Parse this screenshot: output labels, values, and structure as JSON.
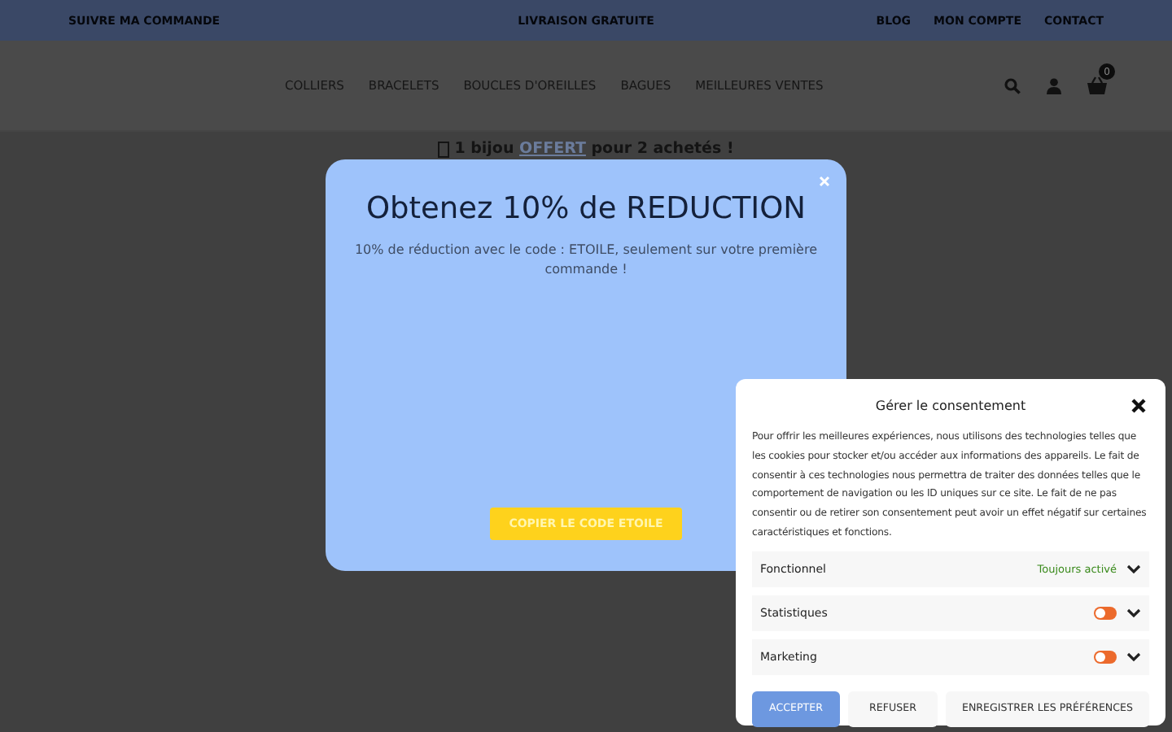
{
  "top_bar": {
    "left": "SUIVRE MA COMMANDE",
    "center": "LIVRAISON GRATUITE",
    "links": [
      "BLOG",
      "MON COMPTE",
      "CONTACT"
    ]
  },
  "nav": {
    "items": [
      "COLLIERS",
      "BRACELETS",
      "BOUCLES D'OREILLES",
      "BAGUES",
      "MEILLEURES VENTES"
    ],
    "cart_count": "0"
  },
  "promo": {
    "before": "1 bijou",
    "link": "OFFERT",
    "after": "pour 2 achetés !"
  },
  "popup": {
    "title": "Obtenez 10% de REDUCTION",
    "text": "10% de réduction avec le code : ETOILE, seulement sur votre première commande !",
    "button": "COPIER LE CODE ETOILE"
  },
  "consent": {
    "title": "Gérer le consentement",
    "text": "Pour offrir les meilleures expériences, nous utilisons des technologies telles que les cookies pour stocker et/ou accéder aux informations des appareils. Le fait de consentir à ces technologies nous permettra de traiter des données telles que le comportement de navigation ou les ID uniques sur ce site. Le fait de ne pas consentir ou de retirer son consentement peut avoir un effet négatif sur certaines caractéristiques et fonctions.",
    "categories": [
      {
        "kind": "always",
        "label": "Fonctionnel",
        "status": "Toujours activé",
        "expanded": false
      },
      {
        "kind": "toggle",
        "label": "Statistiques",
        "on": false,
        "expanded": false
      },
      {
        "kind": "toggle",
        "label": "Marketing",
        "on": false,
        "expanded": false
      }
    ],
    "buttons": [
      "ACCEPTER",
      "REFUSER",
      "ENREGISTRER LES PRÉFÉRENCES"
    ]
  }
}
